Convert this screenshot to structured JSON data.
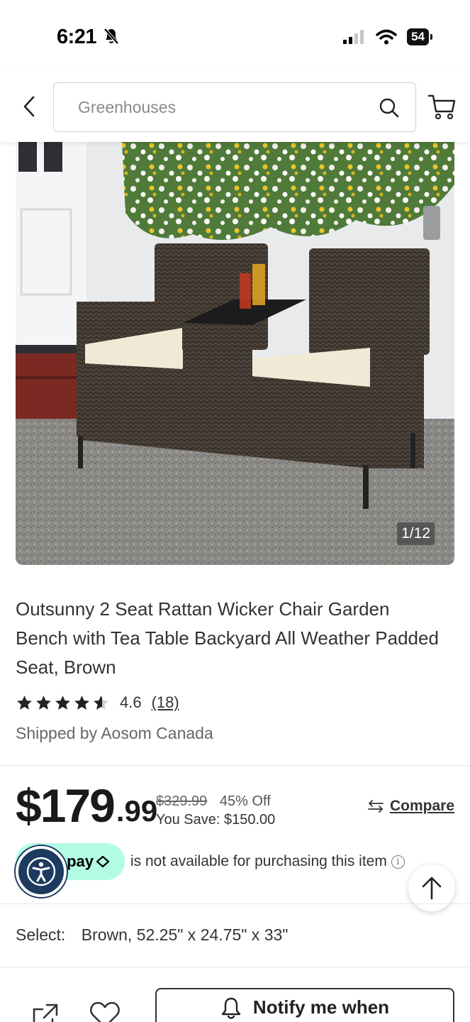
{
  "status_bar": {
    "time": "6:21",
    "battery": "54",
    "icons": [
      "bell-slash-icon",
      "cellular-signal-icon",
      "wifi-icon",
      "battery-icon"
    ]
  },
  "header": {
    "search_placeholder": "Greenhouses",
    "icons": [
      "chevron-left-icon",
      "search-icon",
      "cart-icon"
    ]
  },
  "gallery": {
    "counter": "1/12"
  },
  "product": {
    "title": "Outsunny 2 Seat Rattan Wicker Chair Garden Bench with Tea Table Backyard All Weather Padded Seat, Brown",
    "rating": 4.6,
    "rating_label": "4.6",
    "review_count": "(18)",
    "shipped_by": "Shipped by Aosom Canada"
  },
  "price": {
    "dollars": "$179",
    "cents": ".99",
    "original": "$329.99",
    "discount": "45% Off",
    "savings": "You Save: $150.00",
    "compare_label": "Compare"
  },
  "afterpay": {
    "logo_text": "pay",
    "message": "is not available for purchasing this item"
  },
  "variant": {
    "label": "Select:",
    "value": "Brown, 52.25\" x 24.75\" x 33\""
  },
  "actions": {
    "notify_label": "Notify me when"
  },
  "colors": {
    "afterpay_mint": "#b2fce4",
    "accessibility_navy": "#1d3a5f",
    "text_dark": "#222222"
  }
}
